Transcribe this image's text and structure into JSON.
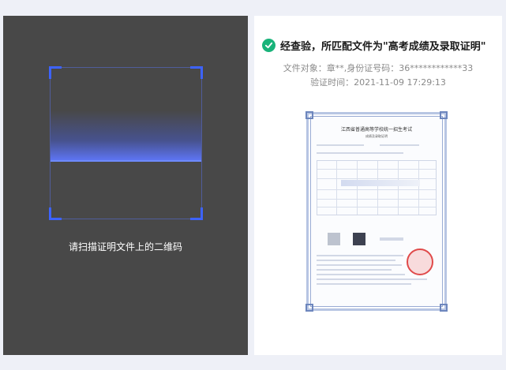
{
  "scanner": {
    "hint": "请扫描证明文件上的二维码"
  },
  "result": {
    "title": "经查验，所匹配文件为\"高考成绩及录取证明\"",
    "subject_line": "文件对象：章**,身份证号码：36************33",
    "time_line": "验证时间：2021-11-09 17:29:13",
    "status_icon": "check-circle-icon",
    "status_color": "#19b37a"
  },
  "certificate": {
    "title": "江西省普通高等学校统一招生考试",
    "subtitle": "成绩及录取证明"
  },
  "colors": {
    "scan_accent": "#3d63ff",
    "scanner_bg": "#484848"
  }
}
